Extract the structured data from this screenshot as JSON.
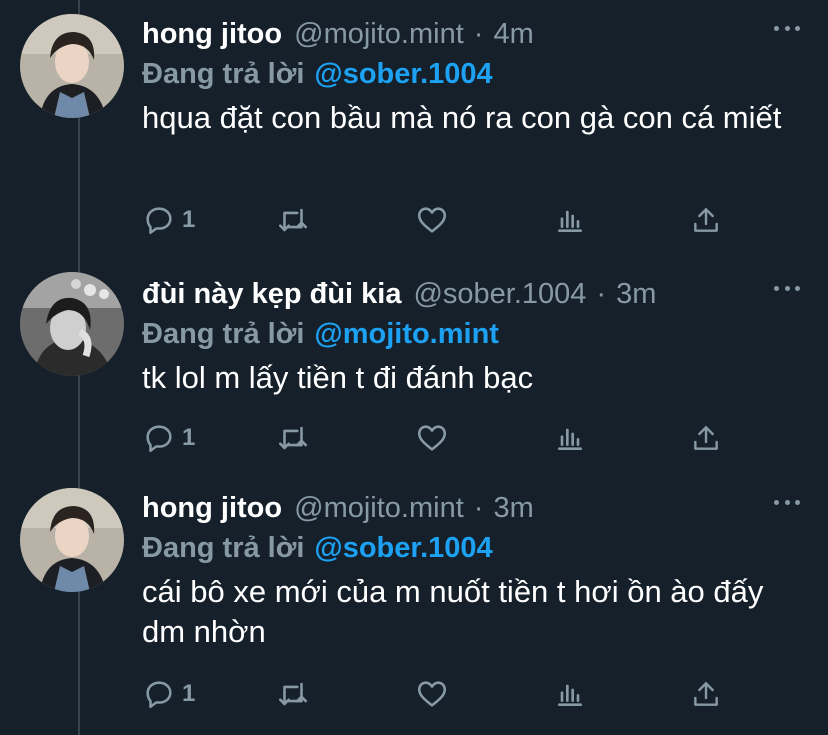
{
  "tweets": [
    {
      "author": "hong jitoo",
      "handle": "@mojito.mint",
      "time": "4m",
      "replying_label": "Đang trả lời",
      "replying_to": "@sober.1004",
      "text": "hqua đặt con bầu mà nó ra con gà con cá miết",
      "reply_count": "1"
    },
    {
      "author": "đùi này kẹp đùi kia",
      "handle": "@sober.1004",
      "time": "3m",
      "replying_label": "Đang trả lời",
      "replying_to": "@mojito.mint",
      "text": "tk lol m lấy tiền t đi đánh bạc",
      "reply_count": "1"
    },
    {
      "author": "hong jitoo",
      "handle": "@mojito.mint",
      "time": "3m",
      "replying_label": "Đang trả lời",
      "replying_to": "@sober.1004",
      "text": "cái bô xe mới của m nuốt tiền t hơi ồn ào đấy dm nhờn",
      "reply_count": "1"
    }
  ],
  "separator": "·",
  "icons": {
    "reply": "reply-icon",
    "retweet": "retweet-icon",
    "like": "heart-icon",
    "stats": "analytics-icon",
    "share": "share-icon",
    "more": "more-icon"
  },
  "colors": {
    "background": "#15202b",
    "muted": "#8899a6",
    "accent": "#1da1f2",
    "text": "#ffffff"
  }
}
